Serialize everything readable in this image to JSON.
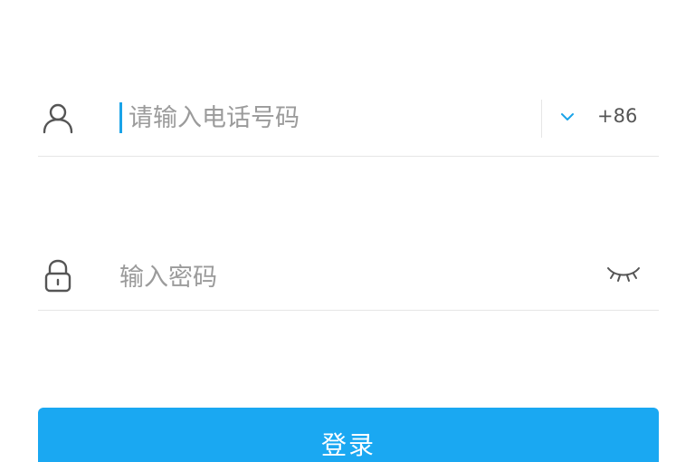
{
  "phone": {
    "icon": "user-icon",
    "placeholder": "请输入电话号码",
    "value": "",
    "country_icon": "chevron-down-icon",
    "country_code": "+86"
  },
  "password": {
    "icon": "lock-icon",
    "placeholder": "输入密码",
    "value": "",
    "toggle_icon": "eye-closed-icon"
  },
  "login": {
    "label": "登录",
    "color": "#1aa8f2"
  },
  "colors": {
    "accent": "#1aa3e8",
    "divider": "#e6e6e6",
    "placeholder": "#9b9b9b"
  }
}
